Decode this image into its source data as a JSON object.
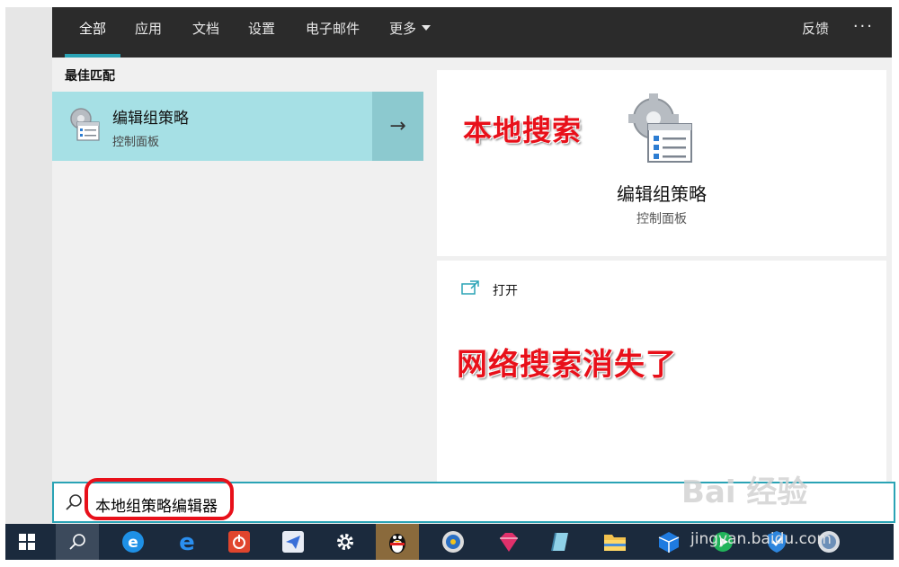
{
  "tabs": [
    {
      "label": "全部",
      "active": true
    },
    {
      "label": "应用",
      "active": false
    },
    {
      "label": "文档",
      "active": false
    },
    {
      "label": "设置",
      "active": false
    },
    {
      "label": "电子邮件",
      "active": false
    },
    {
      "label": "更多",
      "active": false
    }
  ],
  "header": {
    "feedback_label": "反馈",
    "more_options_label": "···"
  },
  "best_match": {
    "heading": "最佳匹配",
    "title": "编辑组策略",
    "subtitle": "控制面板",
    "arrow": "→"
  },
  "detail": {
    "title": "编辑组策略",
    "subtitle": "控制面板",
    "open_label": "打开"
  },
  "annotations": {
    "local_search": "本地搜索",
    "web_search_gone": "网络搜索消失了"
  },
  "search": {
    "value": "本地组策略编辑器"
  },
  "watermark": {
    "logo": "Bai 经验",
    "url": "jingyan.baidu.com"
  },
  "colors": {
    "accent": "#2aa3b5",
    "highlight": "#a6e0e5",
    "annotation_red": "#e8101a",
    "taskbar": "#1b2a3d"
  }
}
